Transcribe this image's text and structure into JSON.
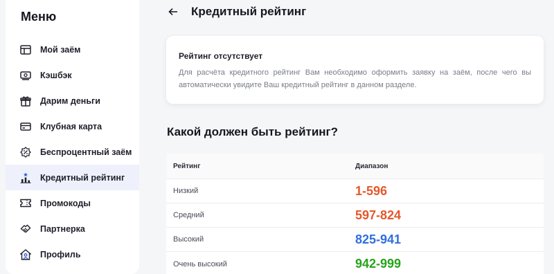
{
  "sidebar": {
    "title": "Меню",
    "items": [
      {
        "label": "Мой заём",
        "icon": "dashboard-icon"
      },
      {
        "label": "Кэшбэк",
        "icon": "cash-icon"
      },
      {
        "label": "Дарим деньги",
        "icon": "gift-icon"
      },
      {
        "label": "Клубная карта",
        "icon": "card-icon"
      },
      {
        "label": "Беспроцентный заём",
        "icon": "percent-icon"
      },
      {
        "label": "Кредитный рейтинг",
        "icon": "rating-icon",
        "active": true
      },
      {
        "label": "Промокоды",
        "icon": "ticket-icon"
      },
      {
        "label": "Партнерка",
        "icon": "handshake-icon"
      },
      {
        "label": "Профиль",
        "icon": "profile-icon"
      }
    ]
  },
  "header": {
    "title": "Кредитный рейтинг"
  },
  "notice": {
    "title": "Рейтинг отсутствует",
    "text": "Для расчёта кредитного рейтинг Вам необходимо оформить заявку на заём, после чего вы автоматически увидите Ваш кредитный рейтинг в данном разделе."
  },
  "section": {
    "title": "Какой должен быть рейтинг?"
  },
  "table": {
    "headers": [
      "Рейтинг",
      "Диапазон"
    ],
    "rows": [
      {
        "name": "Низкий",
        "range": "1-596",
        "color": "#e4582b"
      },
      {
        "name": "Средний",
        "range": "597-824",
        "color": "#e4582b"
      },
      {
        "name": "Высокий",
        "range": "825-941",
        "color": "#2f6ee0"
      },
      {
        "name": "Очень высокий",
        "range": "942-999",
        "color": "#27a31a"
      }
    ]
  }
}
